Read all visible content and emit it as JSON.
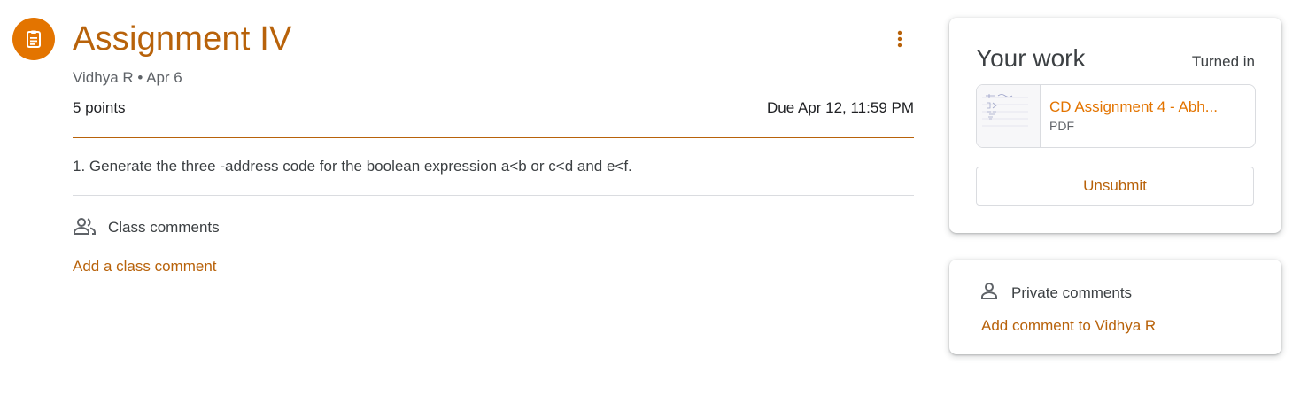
{
  "assignment": {
    "icon": "assignment-icon",
    "title": "Assignment IV",
    "author_date": "Vidhya R • Apr 6",
    "points": "5 points",
    "due": "Due Apr 12, 11:59 PM",
    "description": "1. Generate the three -address code for the boolean expression a<b or c<d and e<f.",
    "more_icon": "more-vert-icon",
    "accent_color": "#b8620a",
    "icon_bg_color": "#e37400"
  },
  "class_comments": {
    "icon": "people-icon",
    "label": "Class comments",
    "add_link": "Add a class comment"
  },
  "your_work": {
    "title": "Your work",
    "status": "Turned in",
    "attachment": {
      "name": "CD Assignment 4 - Abh...",
      "type": "PDF",
      "thumbnail": "pdf-thumbnail"
    },
    "unsubmit_label": "Unsubmit"
  },
  "private_comments": {
    "icon": "person-icon",
    "label": "Private comments",
    "add_link": "Add comment to Vidhya R"
  }
}
